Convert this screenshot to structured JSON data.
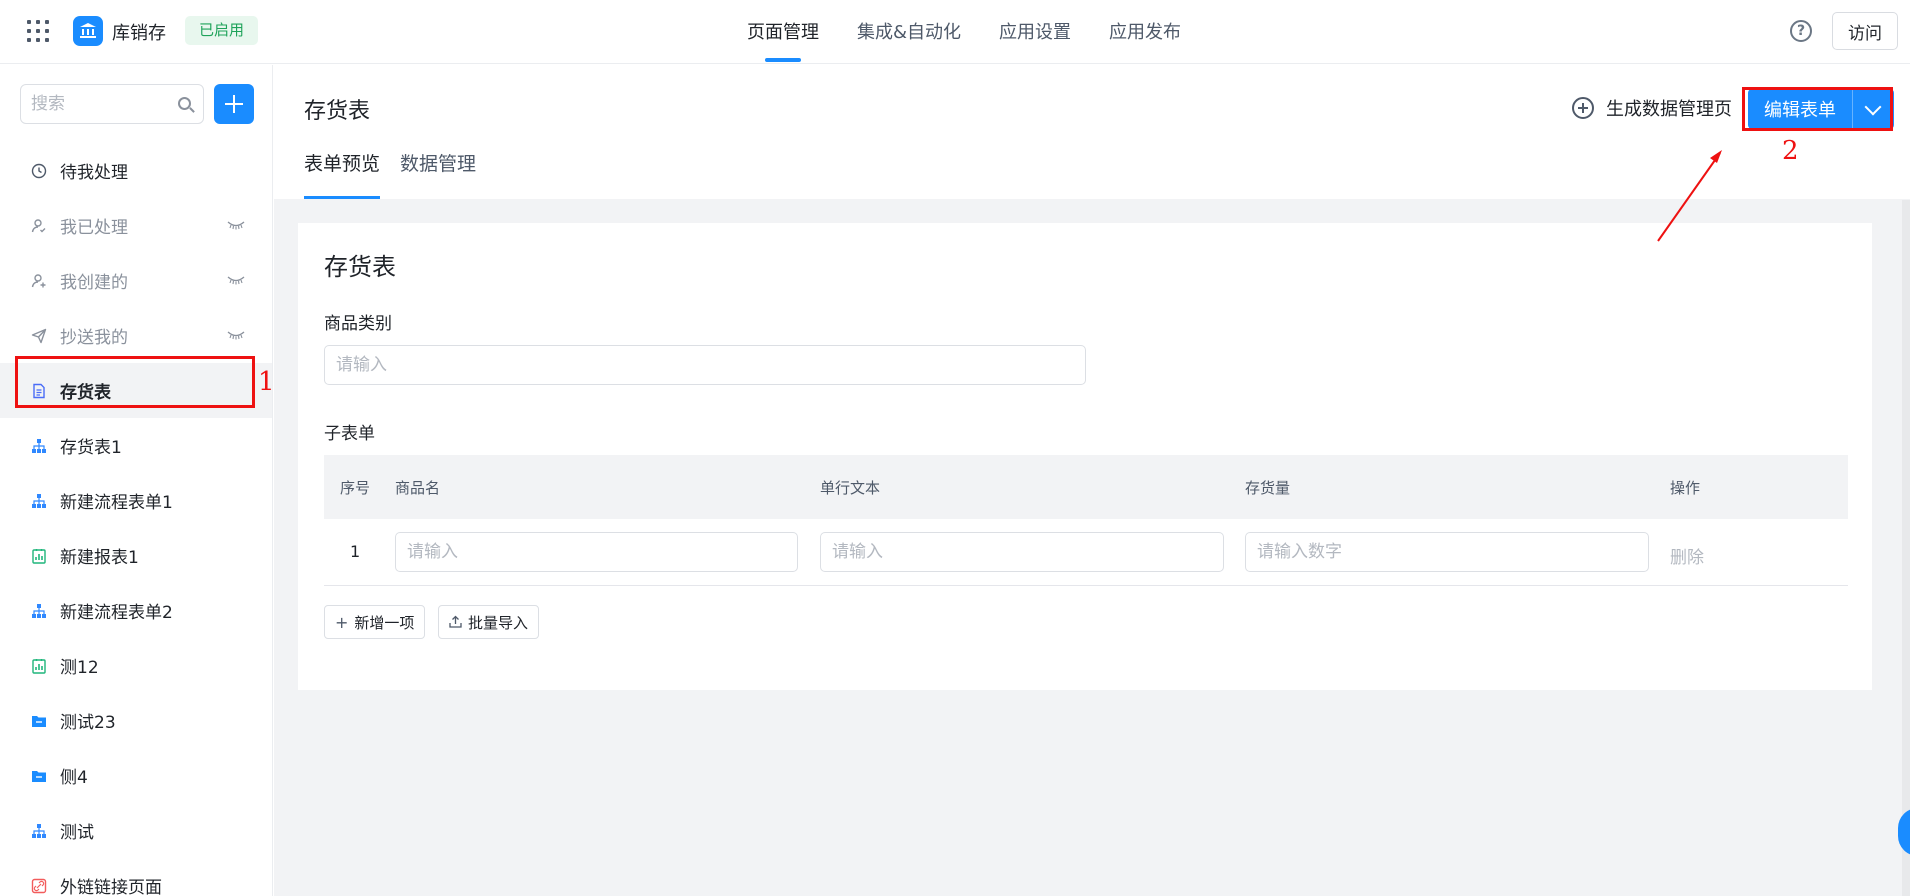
{
  "topbar": {
    "app_name": "库销存",
    "status": "已启用",
    "nav": [
      "页面管理",
      "集成&自动化",
      "应用设置",
      "应用发布"
    ],
    "active_nav": 0,
    "help_symbol": "?",
    "visit_label": "访问"
  },
  "sidebar": {
    "search_placeholder": "搜索",
    "items": [
      {
        "label": "待我处理",
        "icon": "clock-icon"
      },
      {
        "label": "我已处理",
        "icon": "user-check-icon",
        "hidden": true
      },
      {
        "label": "我创建的",
        "icon": "user-add-icon",
        "hidden": true
      },
      {
        "label": "抄送我的",
        "icon": "send-icon",
        "hidden": true
      },
      {
        "label": "存货表",
        "icon": "form-icon",
        "selected": true
      },
      {
        "label": "存货表1",
        "icon": "flow-icon"
      },
      {
        "label": "新建流程表单1",
        "icon": "flow-icon"
      },
      {
        "label": "新建报表1",
        "icon": "report-icon"
      },
      {
        "label": "新建流程表单2",
        "icon": "flow-icon"
      },
      {
        "label": "测12",
        "icon": "report-icon"
      },
      {
        "label": "测试23",
        "icon": "folder-icon"
      },
      {
        "label": "侧4",
        "icon": "folder-icon"
      },
      {
        "label": "测试",
        "icon": "flow-icon"
      },
      {
        "label": "外链链接页面",
        "icon": "link-page-icon"
      }
    ]
  },
  "annotations": {
    "first": "1",
    "second": "2"
  },
  "main": {
    "title": "存货表",
    "tabs": [
      "表单预览",
      "数据管理"
    ],
    "generate_label": "生成数据管理页",
    "edit_label": "编辑表单"
  },
  "form": {
    "title": "存货表",
    "field_category_label": "商品类别",
    "field_category_placeholder": "请输入",
    "subform_label": "子表单",
    "columns": [
      "序号",
      "商品名",
      "单行文本",
      "存货量",
      "操作"
    ],
    "row": {
      "index": "1",
      "name_placeholder": "请输入",
      "text_placeholder": "请输入",
      "qty_placeholder": "请输入数字",
      "delete_label": "删除"
    },
    "add_item_label": "新增一项",
    "batch_import_label": "批量导入"
  },
  "colors": {
    "accent": "#1a8cff",
    "annotation": "#ee1111"
  }
}
